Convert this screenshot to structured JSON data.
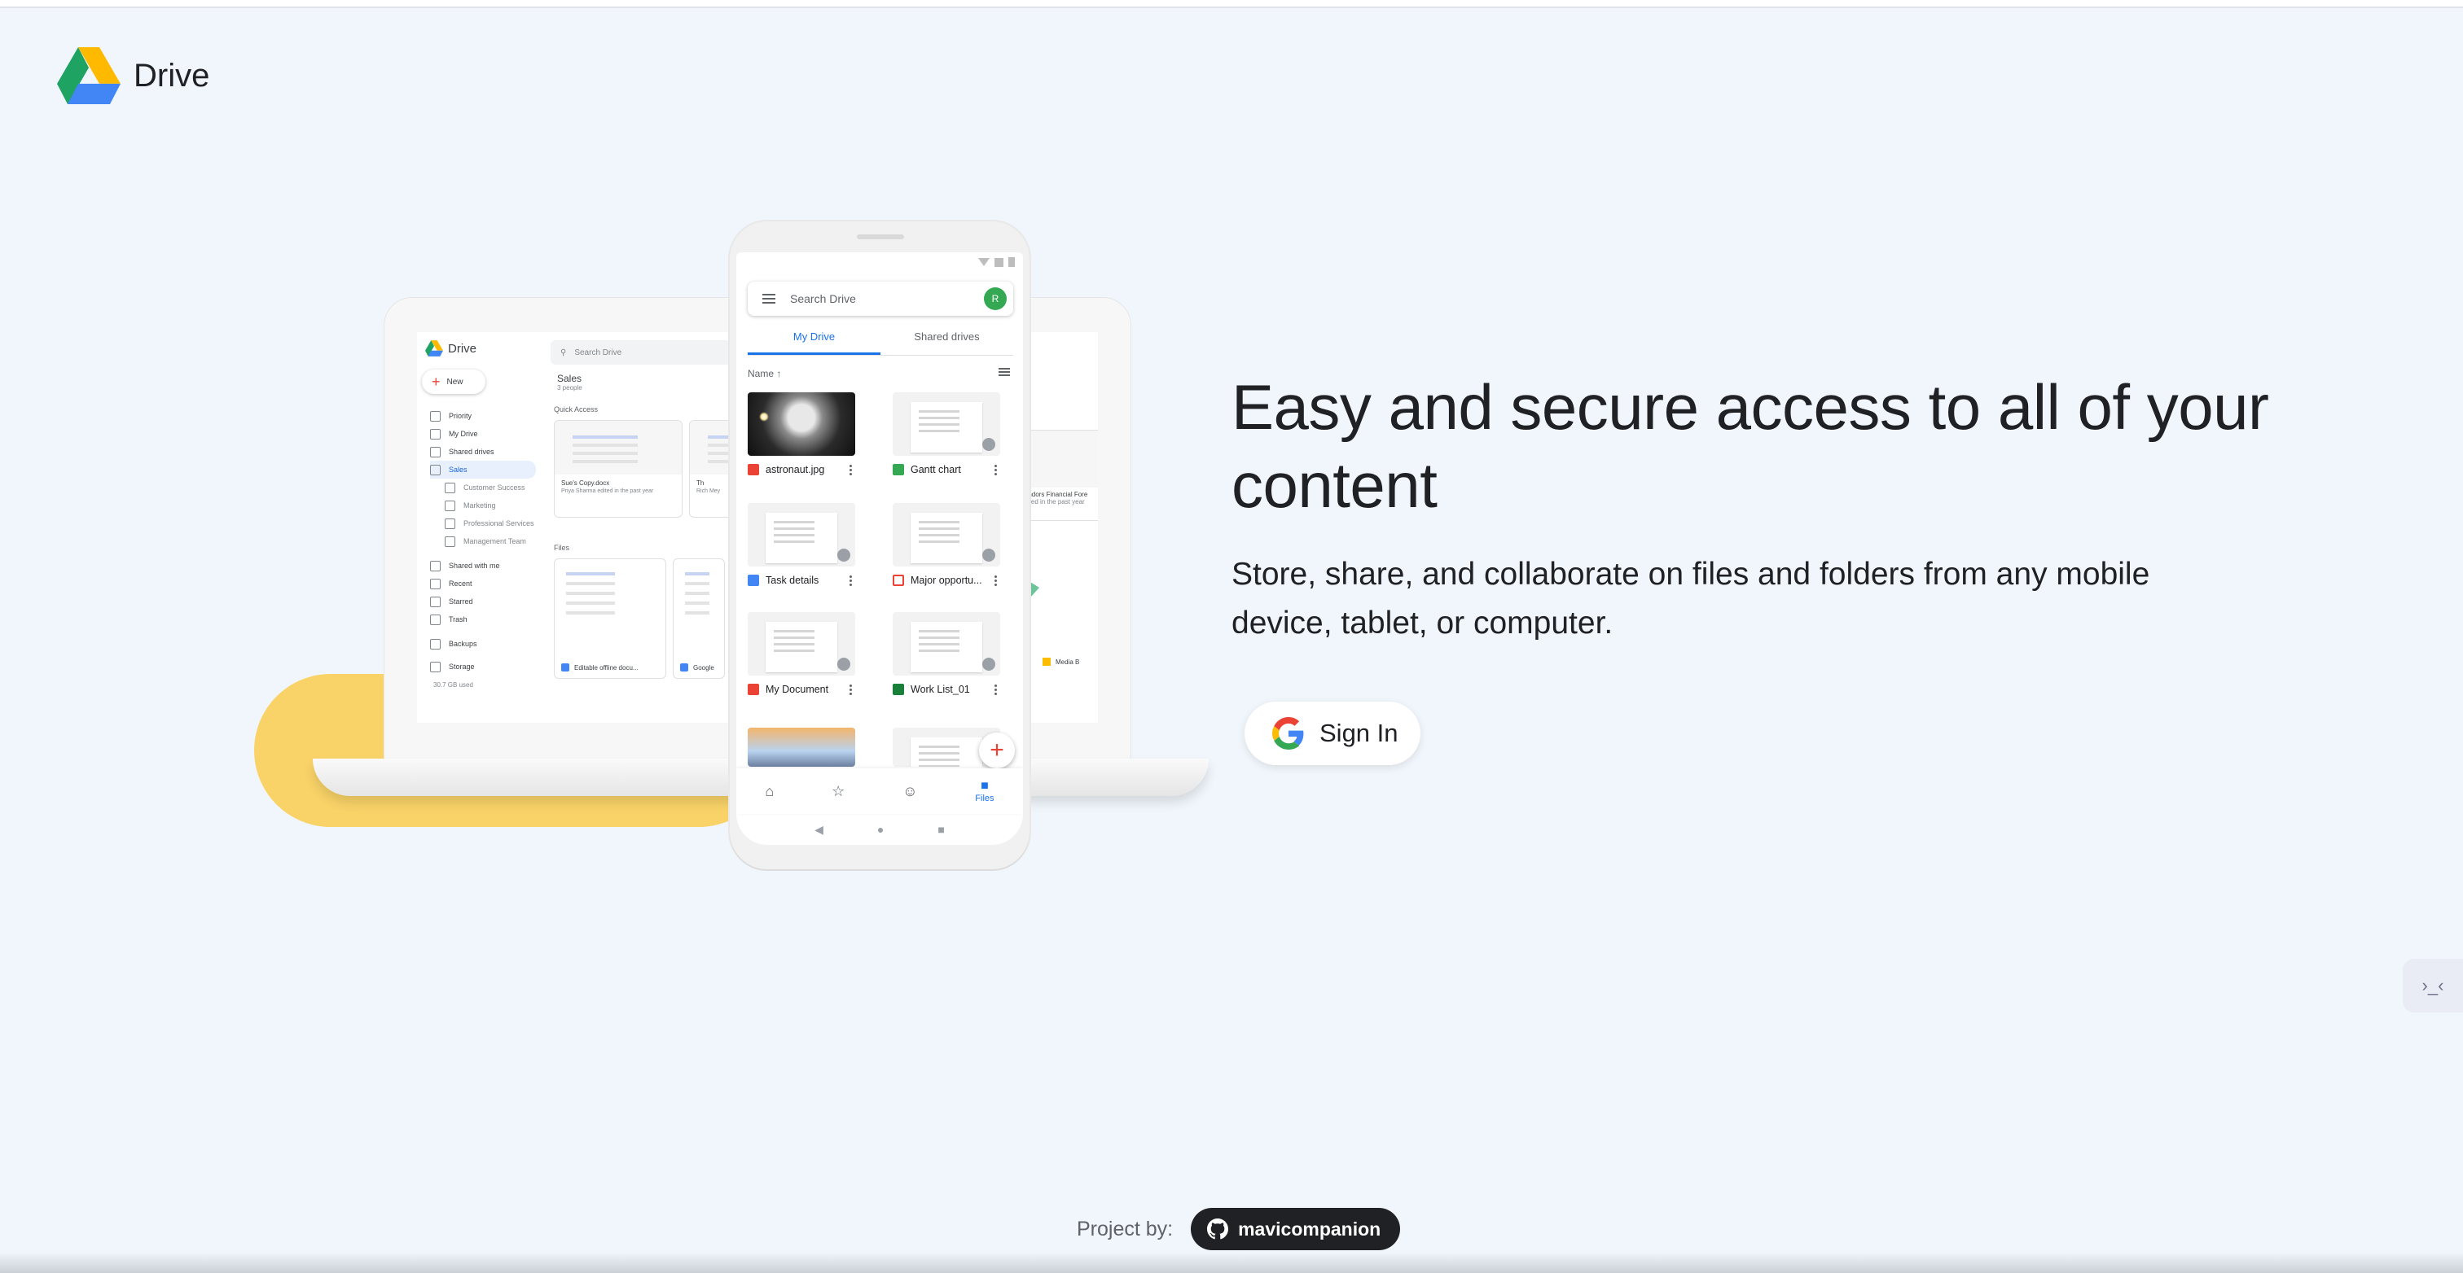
{
  "header": {
    "app_name": "Drive",
    "logo_icon": "google-drive-logo",
    "colors": {
      "green": "#1ea362",
      "yellow": "#ffba00",
      "blue": "#4285f4"
    }
  },
  "hero": {
    "title": "Easy and secure access to all of your content",
    "subtitle": "Store, share, and collaborate on files and folders from any mobile device, tablet, or computer.",
    "signin_label": "Sign In",
    "signin_icon": "google-g-icon"
  },
  "footer": {
    "label": "Project by:",
    "github_user": "mavicompanion",
    "github_icon": "github-icon"
  },
  "side_handle": {
    "icon": "collapse-icon",
    "glyph": "›_‹"
  },
  "laptop": {
    "app_name": "Drive",
    "new_label": "New",
    "search_placeholder": "Search Drive",
    "nav": [
      {
        "label": "Priority"
      },
      {
        "label": "My Drive"
      },
      {
        "label": "Shared drives"
      },
      {
        "label": "Sales",
        "selected": true
      },
      {
        "label": "Customer Success",
        "sub": true
      },
      {
        "label": "Marketing",
        "sub": true
      },
      {
        "label": "Professional Services",
        "sub": true
      },
      {
        "label": "Management Team",
        "sub": true
      },
      {
        "label": "Shared with me"
      },
      {
        "label": "Recent"
      },
      {
        "label": "Starred"
      },
      {
        "label": "Trash"
      },
      {
        "label": "Backups"
      },
      {
        "label": "Storage"
      }
    ],
    "storage_used": "30.7 GB used",
    "folder_title": "Sales",
    "folder_people": "3 people",
    "quick_access_label": "Quick Access",
    "qa_card": {
      "title": "Sue's Copy.docx",
      "meta": "Priya Sharma edited in the past year"
    },
    "qa_card2_fragment": "Th",
    "qa_card2_meta": "Rich Mey",
    "right_card": {
      "title": "Vendors Financial Fore",
      "meta": "edited in the past year"
    },
    "files_label": "Files",
    "file1": "Editable offline docu...",
    "file2": "Google",
    "file3": "Media B"
  },
  "phone": {
    "search_placeholder": "Search Drive",
    "avatar_initial": "R",
    "tabs": [
      "My Drive",
      "Shared drives"
    ],
    "sort_label": "Name ↑",
    "files": [
      {
        "name": "astronaut.jpg",
        "icon_color": "#ea4335"
      },
      {
        "name": "Gantt chart",
        "icon_color": "#34a853"
      },
      {
        "name": "Task details",
        "icon_color": "#4285f4"
      },
      {
        "name": "Major opportu...",
        "icon_color": "#ea4335"
      },
      {
        "name": "My Document",
        "icon_color": "#ea4335"
      },
      {
        "name": "Work List_01",
        "icon_color": "#188038"
      }
    ],
    "bottom_nav": [
      {
        "label": "",
        "icon": "home-icon",
        "glyph": "⌂"
      },
      {
        "label": "",
        "icon": "star-icon",
        "glyph": "☆"
      },
      {
        "label": "",
        "icon": "shared-icon",
        "glyph": "☺"
      },
      {
        "label": "Files",
        "icon": "folder-icon",
        "glyph": "■"
      }
    ],
    "fab_glyph": "+"
  }
}
